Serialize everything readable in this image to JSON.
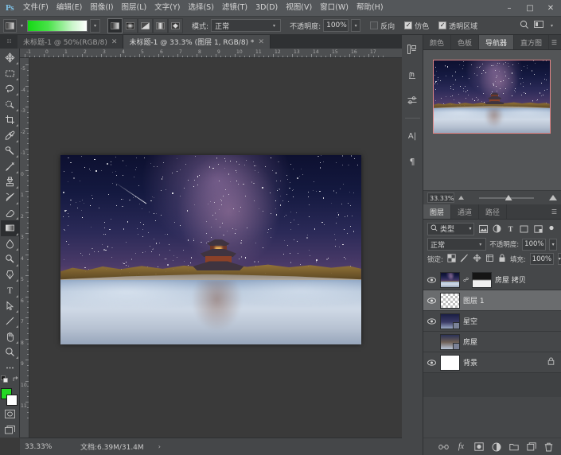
{
  "app": {
    "logo": "Ps",
    "title": "Adobe Photoshop"
  },
  "window_controls": {
    "minimize": "–",
    "maximize": "□",
    "close": "✕"
  },
  "menu": {
    "items": [
      {
        "label": "文件(F)"
      },
      {
        "label": "编辑(E)"
      },
      {
        "label": "图像(I)"
      },
      {
        "label": "图层(L)"
      },
      {
        "label": "文字(Y)"
      },
      {
        "label": "选择(S)"
      },
      {
        "label": "滤镜(T)"
      },
      {
        "label": "3D(D)"
      },
      {
        "label": "视图(V)"
      },
      {
        "label": "窗口(W)"
      },
      {
        "label": "帮助(H)"
      }
    ]
  },
  "options_bar": {
    "gradient_preset_name": "green-to-white-gradient",
    "gradient_colors": [
      "#14d814",
      "#ffffff"
    ],
    "mode_label": "模式:",
    "mode_value": "正常",
    "opacity_label": "不透明度:",
    "opacity_value": "100%",
    "checkboxes": [
      {
        "label": "反向",
        "checked": false
      },
      {
        "label": "仿色",
        "checked": true
      },
      {
        "label": "透明区域",
        "checked": true
      }
    ]
  },
  "tabs": [
    {
      "label": "未标题-1 @ 50%(RGB/8)",
      "active": false,
      "close": "✕"
    },
    {
      "label": "未标题-1 @ 33.3% (图层 1, RGB/8) *",
      "active": true,
      "close": "✕"
    }
  ],
  "toolbar": {
    "tools": [
      {
        "name": "move-tool",
        "active": false
      },
      {
        "name": "marquee-tool",
        "active": false
      },
      {
        "name": "lasso-tool",
        "active": false
      },
      {
        "name": "quick-selection-tool",
        "active": false
      },
      {
        "name": "crop-tool",
        "active": false
      },
      {
        "name": "eyedropper-tool",
        "active": false
      },
      {
        "name": "spot-healing-brush-tool",
        "active": false
      },
      {
        "name": "brush-tool",
        "active": false
      },
      {
        "name": "clone-stamp-tool",
        "active": false
      },
      {
        "name": "history-brush-tool",
        "active": false
      },
      {
        "name": "eraser-tool",
        "active": false
      },
      {
        "name": "gradient-tool",
        "active": true
      },
      {
        "name": "blur-tool",
        "active": false
      },
      {
        "name": "dodge-tool",
        "active": false
      },
      {
        "name": "pen-tool",
        "active": false
      },
      {
        "name": "type-tool",
        "active": false
      },
      {
        "name": "path-selection-tool",
        "active": false
      },
      {
        "name": "line-tool",
        "active": false
      },
      {
        "name": "hand-tool",
        "active": false
      },
      {
        "name": "zoom-tool",
        "active": false
      },
      {
        "name": "edit-toolbar-tool",
        "active": false
      }
    ],
    "foreground_color": "#22d822",
    "background_color": "#ffffff"
  },
  "rulers": {
    "unit": "cm",
    "horizontal_ticks": [
      "-1",
      "0",
      "1",
      "2",
      "3",
      "4",
      "5",
      "6",
      "7",
      "8",
      "9",
      "10",
      "11",
      "12",
      "13",
      "14",
      "15",
      "16",
      "17"
    ],
    "vertical_ticks": [
      "-5",
      "-4",
      "-3",
      "-2",
      "-1",
      "0",
      "1",
      "2",
      "3",
      "4",
      "5",
      "6",
      "7",
      "8",
      "9",
      "10",
      "11"
    ]
  },
  "canvas": {
    "image_title": "forbidden-city-corner-tower-milky-way-night-reflection"
  },
  "status_bar": {
    "zoom": "33.33%",
    "doc_label": "文档:6.39M/31.4M",
    "expand_arrow": "›"
  },
  "right_dock": {
    "rail_icons": [
      {
        "name": "libraries-icon"
      },
      {
        "name": "history-icon"
      },
      {
        "name": "adjustments-icon"
      },
      {
        "name": "character-icon",
        "glyph": "A|"
      },
      {
        "name": "paragraph-icon",
        "glyph": "¶"
      }
    ],
    "top_panel": {
      "tabs": [
        {
          "label": "颜色",
          "active": false
        },
        {
          "label": "色板",
          "active": false
        },
        {
          "label": "导航器",
          "active": true
        },
        {
          "label": "直方图",
          "active": false
        }
      ],
      "menu_glyph": "☰",
      "zoom_value": "33.33%",
      "thumbnail_border_color": "#e08585"
    },
    "layers_panel": {
      "tabs": [
        {
          "label": "图层",
          "active": true
        },
        {
          "label": "通道",
          "active": false
        },
        {
          "label": "路径",
          "active": false
        }
      ],
      "menu_glyph": "☰",
      "filter_label": "类型",
      "filter_icons": [
        "pixel-filter-icon",
        "adjustment-filter-icon",
        "type-filter-icon",
        "shape-filter-icon",
        "smart-object-filter-icon",
        "filter-toggle-icon"
      ],
      "blend_mode": "正常",
      "opacity_label": "不透明度:",
      "opacity_value": "100%",
      "lock_label": "锁定:",
      "lock_icons": [
        "lock-transparent-icon",
        "lock-image-icon",
        "lock-position-icon",
        "lock-artboard-icon",
        "lock-all-icon"
      ],
      "fill_label": "填充:",
      "fill_value": "100%",
      "layers": [
        {
          "name": "房屋 拷贝",
          "visible": true,
          "selected": false,
          "thumb": "photo",
          "has_mask": true,
          "locked": false
        },
        {
          "name": "图层 1",
          "visible": true,
          "selected": true,
          "thumb": "checker",
          "has_mask": false,
          "locked": false
        },
        {
          "name": "星空",
          "visible": true,
          "selected": false,
          "thumb": "photo-smart",
          "has_mask": false,
          "locked": false
        },
        {
          "name": "房屋",
          "visible": false,
          "selected": false,
          "thumb": "photo-smart",
          "has_mask": false,
          "locked": false
        },
        {
          "name": "背景",
          "visible": true,
          "selected": false,
          "thumb": "white",
          "has_mask": false,
          "locked": true
        }
      ],
      "footer_icons": [
        {
          "name": "link-layers-icon",
          "glyph": "∞"
        },
        {
          "name": "layer-style-fx-icon",
          "glyph": "fx"
        },
        {
          "name": "add-layer-mask-icon",
          "glyph": "▣"
        },
        {
          "name": "new-adjustment-layer-icon",
          "glyph": "◑"
        },
        {
          "name": "new-group-icon",
          "glyph": "▰"
        },
        {
          "name": "new-layer-icon",
          "glyph": "⧉"
        },
        {
          "name": "delete-layer-icon",
          "glyph": "Ὕ1"
        }
      ]
    }
  }
}
